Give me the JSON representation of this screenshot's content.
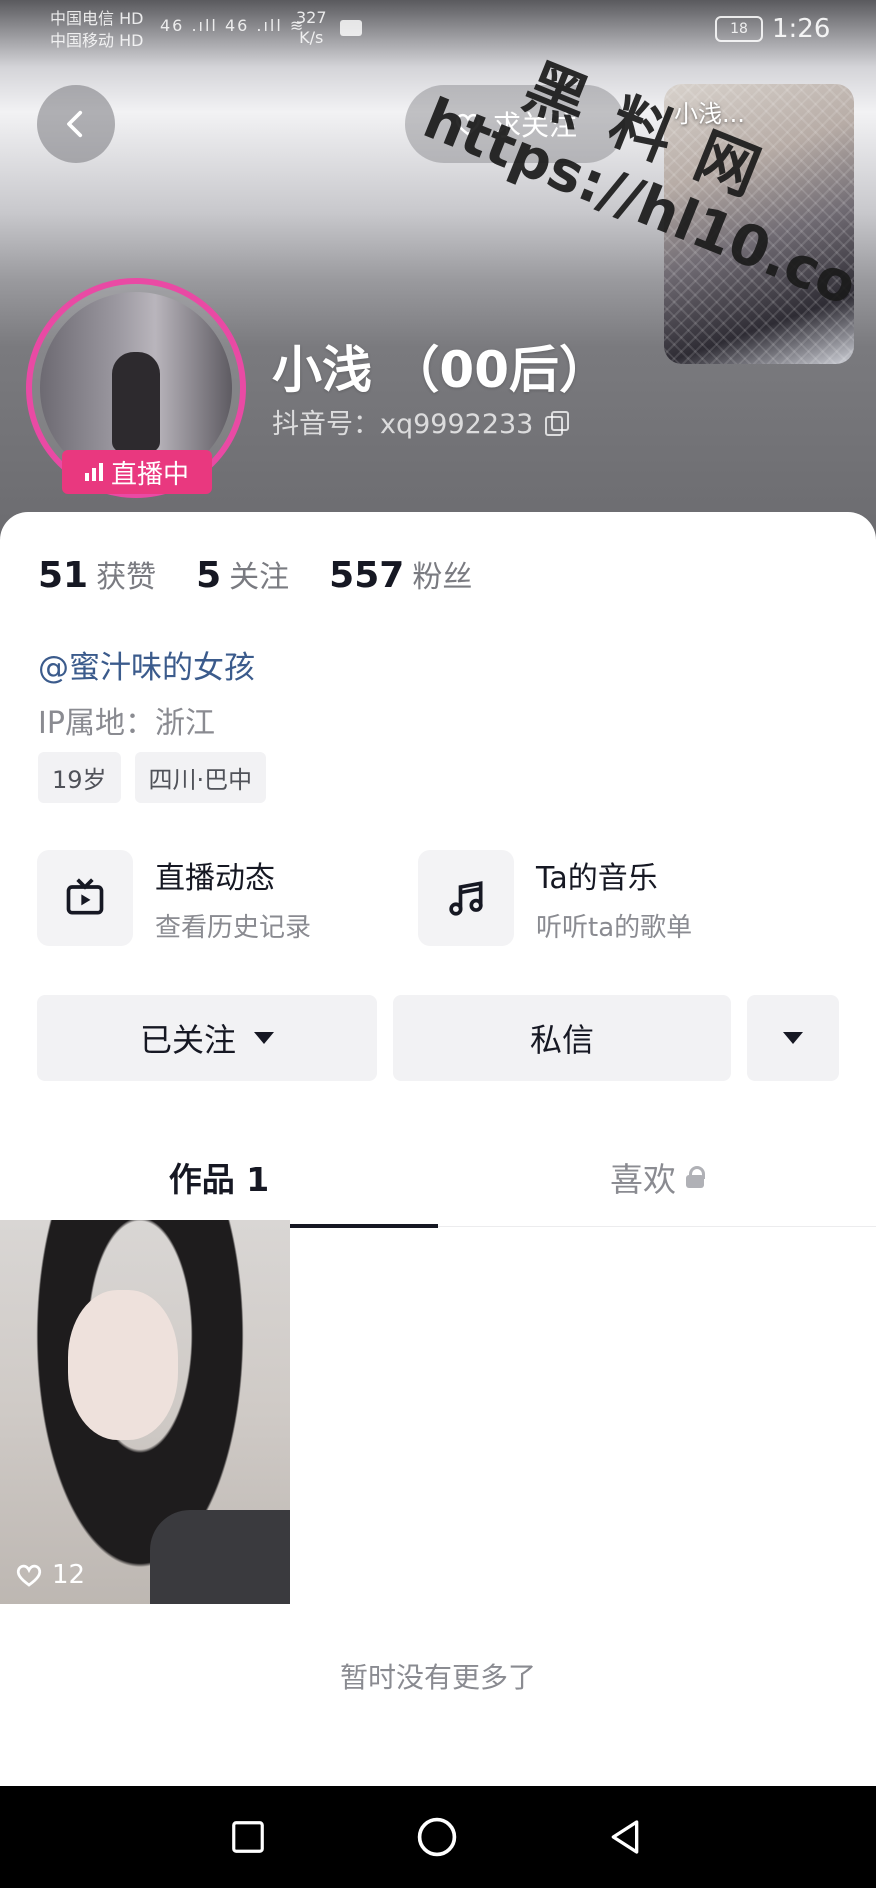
{
  "status_bar": {
    "carrier_line1": "中国电信 HD",
    "carrier_line2": "中国移动 HD",
    "signal": "46 .ıll 46 .ıll ≋",
    "speed_value": "327",
    "speed_unit": "K/s",
    "battery": "18",
    "time": "1:26"
  },
  "header": {
    "pill_label": "求关注",
    "live_preview_name": "小浅...",
    "nickname": "小浅 （00后）",
    "douyin_id": "抖音号：xq9992233",
    "live_badge": "直播中"
  },
  "watermark": {
    "text_cn": "黑料网",
    "url": "https://hl10.co"
  },
  "stats": [
    {
      "num": "51",
      "label": "获赞"
    },
    {
      "num": "5",
      "label": "关注"
    },
    {
      "num": "557",
      "label": "粉丝"
    }
  ],
  "profile": {
    "bio": "@蜜汁味的女孩",
    "ip": "IP属地：浙江",
    "tags": [
      "19岁",
      "四川·巴中"
    ]
  },
  "features": [
    {
      "title": "直播动态",
      "sub": "查看历史记录",
      "icon": "tv-icon"
    },
    {
      "title": "Ta的音乐",
      "sub": "听听ta的歌单",
      "icon": "music-note-icon"
    }
  ],
  "actions": {
    "followed": "已关注",
    "message": "私信"
  },
  "tabs": {
    "works": "作品 1",
    "likes": "喜欢"
  },
  "videos": [
    {
      "likes": "12"
    }
  ],
  "footer_text": "暂时没有更多了"
}
